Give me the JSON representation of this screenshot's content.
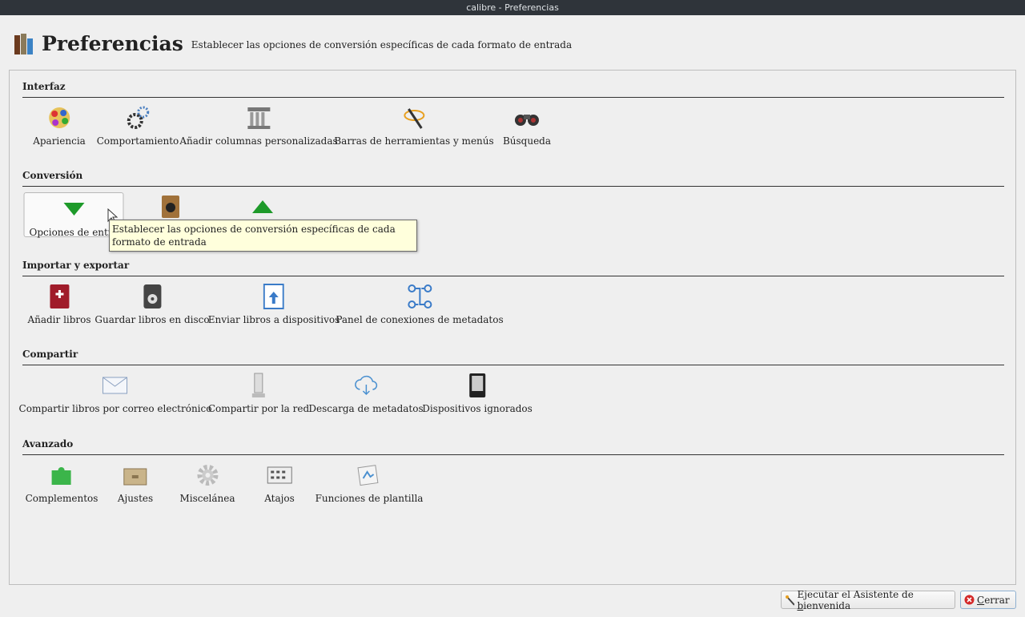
{
  "window": {
    "title": "calibre - Preferencias"
  },
  "header": {
    "title": "Preferencias",
    "subtitle": "Establecer las opciones de conversión específicas de cada formato de entrada"
  },
  "sections": [
    {
      "title": "Interfaz",
      "items": [
        {
          "label": "Apariencia",
          "icon": "palette-icon"
        },
        {
          "label": "Comportamiento",
          "icon": "gears-icon"
        },
        {
          "label": "Añadir columnas personalizadas",
          "icon": "column-icon"
        },
        {
          "label": "Barras de herramientas y menús",
          "icon": "wand-icon"
        },
        {
          "label": "Búsqueda",
          "icon": "binoculars-icon"
        }
      ]
    },
    {
      "title": "Conversión",
      "items": [
        {
          "label": "Opciones de entrada",
          "icon": "arrow-down-icon"
        },
        {
          "label": "",
          "icon": "convert-book-icon"
        },
        {
          "label": "",
          "icon": "arrow-up-icon"
        }
      ]
    },
    {
      "title": "Importar y exportar",
      "items": [
        {
          "label": "Añadir libros",
          "icon": "add-book-icon"
        },
        {
          "label": "Guardar libros en disco",
          "icon": "save-disk-icon"
        },
        {
          "label": "Enviar libros a dispositivos",
          "icon": "send-device-icon"
        },
        {
          "label": "Panel de conexiones de metadatos",
          "icon": "metadata-plugboard-icon"
        }
      ]
    },
    {
      "title": "Compartir",
      "items": [
        {
          "label": "Compartir libros por correo electrónico",
          "icon": "mail-icon"
        },
        {
          "label": "Compartir por la red",
          "icon": "network-server-icon"
        },
        {
          "label": "Descarga de metadatos",
          "icon": "cloud-download-icon"
        },
        {
          "label": "Dispositivos ignorados",
          "icon": "ereader-icon"
        }
      ]
    },
    {
      "title": "Avanzado",
      "items": [
        {
          "label": "Complementos",
          "icon": "puzzle-icon"
        },
        {
          "label": "Ajustes",
          "icon": "drawer-icon"
        },
        {
          "label": "Miscelánea",
          "icon": "gear-icon"
        },
        {
          "label": "Atajos",
          "icon": "keyboard-icon"
        },
        {
          "label": "Funciones de plantilla",
          "icon": "template-icon"
        }
      ]
    }
  ],
  "tooltip": {
    "text": "Establecer las opciones de conversión específicas de cada formato de entrada"
  },
  "buttons": {
    "wizard_pre": "Ejecutar el Asistente de ",
    "wizard_u": "b",
    "wizard_post": "ienvenida",
    "close_u": "C",
    "close_post": "errar"
  }
}
